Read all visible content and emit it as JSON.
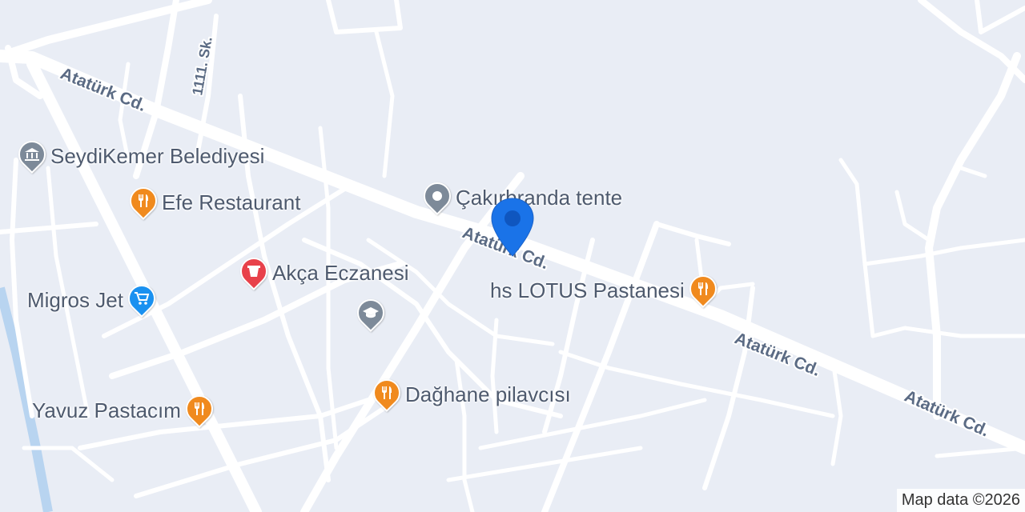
{
  "colors": {
    "background": "#e9edf5",
    "road": "#ffffff",
    "water": "#b8d4f0",
    "restaurant": "#f08a1e",
    "pharmacy": "#e8414a",
    "shopping": "#1a91f0",
    "civic": "#7d8a99",
    "generic": "#7d8a99",
    "marker": "#1a73e8"
  },
  "roads": {
    "main": "Atatürk Cd.",
    "side": "1111. Sk."
  },
  "pois": [
    {
      "name": "SeydiKemer Belediyesi",
      "icon": "city-hall-icon",
      "category": "civic"
    },
    {
      "name": "Efe Restaurant",
      "icon": "fork-knife-icon",
      "category": "restaurant"
    },
    {
      "name": "Çakırbranda tente",
      "icon": "map-pin-icon",
      "category": "generic"
    },
    {
      "name": "Akça Eczanesi",
      "icon": "pharmacy-icon",
      "category": "pharmacy"
    },
    {
      "name": "Migros Jet",
      "icon": "shopping-cart-icon",
      "category": "shopping"
    },
    {
      "name": "",
      "icon": "graduation-cap-icon",
      "category": "civic"
    },
    {
      "name": "hs LOTUS Pastanesi",
      "icon": "fork-knife-icon",
      "category": "restaurant"
    },
    {
      "name": "Dağhane pilavcısı",
      "icon": "fork-knife-icon",
      "category": "restaurant"
    },
    {
      "name": "Yavuz Pastacım",
      "icon": "fork-knife-icon",
      "category": "restaurant"
    }
  ],
  "attribution": "Map data ©2026"
}
